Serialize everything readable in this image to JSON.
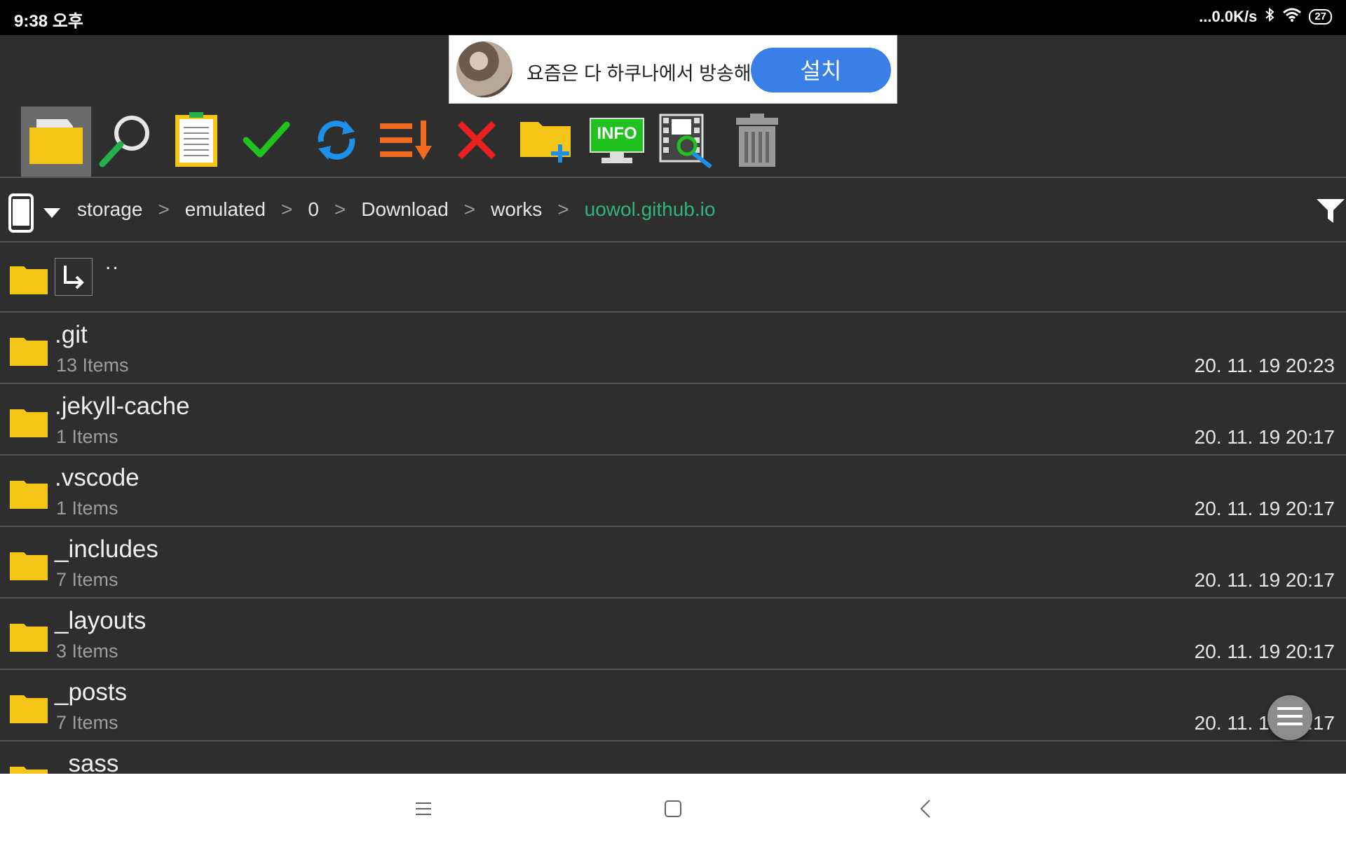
{
  "status_bar": {
    "time": "9:38 오후",
    "net_speed": "...0.0K/s",
    "battery": "27"
  },
  "ad": {
    "text": "요즘은 다 하쿠나에서 방송해",
    "button": "설치"
  },
  "toolbar": {
    "icons": [
      "folder-icon",
      "search-icon",
      "clipboard-icon",
      "check-icon",
      "refresh-icon",
      "sort-icon",
      "close-icon",
      "new-folder-icon",
      "info-icon",
      "media-scan-icon",
      "trash-icon"
    ],
    "info_label": "INFO"
  },
  "path": {
    "segments": [
      "storage",
      "emulated",
      "0",
      "Download",
      "works",
      "uowol.github.io"
    ],
    "current_color": "#2fb57d"
  },
  "parent_entry": "..",
  "files": [
    {
      "name": ".git",
      "items": "13 Items",
      "date": "20. 11. 19 20:23"
    },
    {
      "name": ".jekyll-cache",
      "items": "1 Items",
      "date": "20. 11. 19 20:17"
    },
    {
      "name": ".vscode",
      "items": "1 Items",
      "date": "20. 11. 19 20:17"
    },
    {
      "name": "_includes",
      "items": "7 Items",
      "date": "20. 11. 19 20:17"
    },
    {
      "name": "_layouts",
      "items": "3 Items",
      "date": "20. 11. 19 20:17"
    },
    {
      "name": "_posts",
      "items": "7 Items",
      "date": "20. 11. 19 20:17"
    },
    {
      "name": "_sass",
      "items": "",
      "date": ""
    }
  ],
  "colors": {
    "folder": "#f5c518",
    "background": "#2e2e2e",
    "accent": "#2fb57d"
  }
}
